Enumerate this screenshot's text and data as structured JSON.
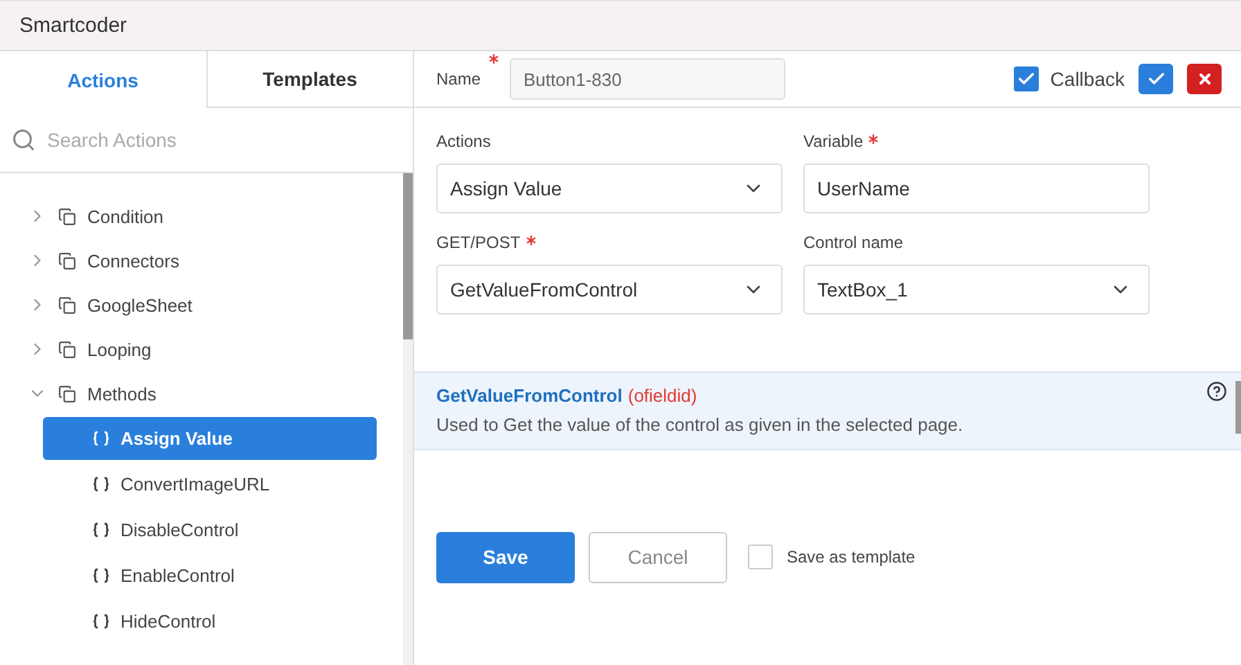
{
  "window": {
    "title": "Smartcoder"
  },
  "tabs": [
    {
      "label": "Actions",
      "selected": true
    },
    {
      "label": "Templates",
      "selected": false
    }
  ],
  "search": {
    "placeholder": "Search Actions"
  },
  "tree": [
    {
      "label": "Condition",
      "expanded": false
    },
    {
      "label": "Connectors",
      "expanded": false
    },
    {
      "label": "GoogleSheet",
      "expanded": false
    },
    {
      "label": "Looping",
      "expanded": false
    },
    {
      "label": "Methods",
      "expanded": true,
      "children": [
        {
          "label": "Assign Value",
          "selected": true
        },
        {
          "label": "ConvertImageURL",
          "selected": false
        },
        {
          "label": "DisableControl",
          "selected": false
        },
        {
          "label": "EnableControl",
          "selected": false
        },
        {
          "label": "HideControl",
          "selected": false
        }
      ]
    }
  ],
  "header": {
    "name_label": "Name",
    "name_required": true,
    "name_value": "Button1-830",
    "callback": {
      "label": "Callback",
      "checked": true
    }
  },
  "form": [
    {
      "label": "Actions",
      "required": false,
      "kind": "select",
      "value": "Assign Value"
    },
    {
      "label": "Variable",
      "required": true,
      "kind": "text",
      "value": "UserName"
    },
    {
      "label": "GET/POST",
      "required": true,
      "kind": "select",
      "value": "GetValueFromControl"
    },
    {
      "label": "Control name",
      "required": false,
      "kind": "select",
      "value": "TextBox_1"
    }
  ],
  "help": {
    "title": "GetValueFromControl",
    "param": "(ofieldid)",
    "description": "Used to Get the value of the control as given in the selected page."
  },
  "footer": {
    "save": "Save",
    "cancel": "Cancel",
    "template": {
      "label": "Save as template",
      "checked": false
    }
  }
}
